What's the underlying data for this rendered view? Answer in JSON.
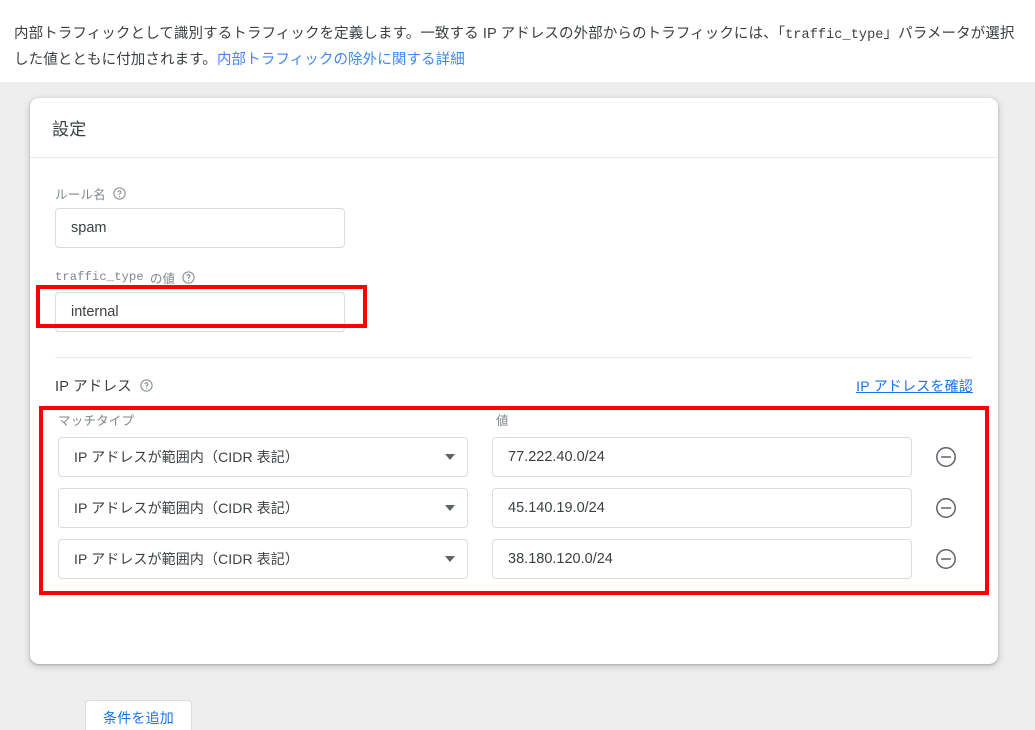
{
  "intro": {
    "line1_part1": "内部トラフィックとして識別するトラフィックを定義します。一致する IP アドレスの外部からのトラフィックには、「",
    "code": "traffic_type",
    "line1_part2": "」パラメ",
    "line2_part1": "ータが選択した値とともに付加されます。",
    "link": "内部トラフィックの除外に関する詳細"
  },
  "card": {
    "title": "設定",
    "rule_name": {
      "label": "ルール名",
      "help_icon": "help-circle-icon",
      "value": "spam"
    },
    "traffic_type": {
      "label_code": "traffic_type",
      "label_suffix": " の値",
      "help_icon": "help-circle-icon",
      "value": "internal"
    },
    "ip_section": {
      "title": "IP アドレス",
      "help_icon": "help-circle-icon",
      "check_link": "IP アドレスを確認",
      "columns": {
        "match_type": "マッチタイプ",
        "value": "値"
      },
      "rows": [
        {
          "match_type": "IP アドレスが範囲内（CIDR 表記）",
          "value": "77.222.40.0/24",
          "remove_icon": "remove-circle-icon",
          "caret_icon": "chevron-down-icon"
        },
        {
          "match_type": "IP アドレスが範囲内（CIDR 表記）",
          "value": "45.140.19.0/24",
          "remove_icon": "remove-circle-icon",
          "caret_icon": "chevron-down-icon"
        },
        {
          "match_type": "IP アドレスが範囲内（CIDR 表記）",
          "value": "38.180.120.0/24",
          "remove_icon": "remove-circle-icon",
          "caret_icon": "chevron-down-icon"
        }
      ],
      "add_condition": "条件を追加"
    }
  },
  "colors": {
    "link": "#1a73e8",
    "intro_link": "#4285f4",
    "highlight": "#ff0000",
    "text": "#3c4043",
    "muted": "#80868b",
    "border": "#dadce0",
    "page_bg": "#eeeeee"
  }
}
